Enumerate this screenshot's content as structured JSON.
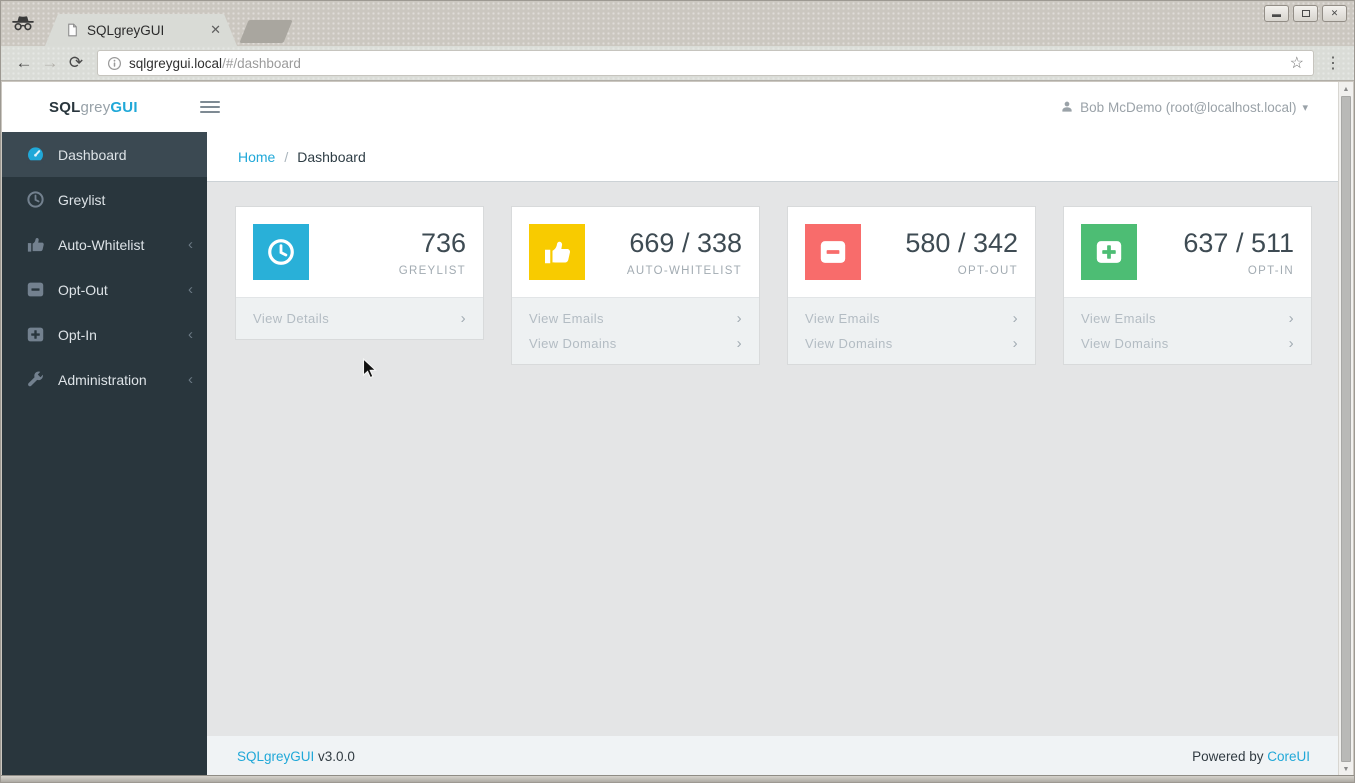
{
  "browser": {
    "tab": {
      "title": "SQLgreyGUI"
    },
    "address": {
      "domain": "sqlgreygui.local",
      "path": "/#/dashboard"
    }
  },
  "header": {
    "logo": {
      "part1": "SQL",
      "part2": "grey",
      "part3": "GUI"
    },
    "user": {
      "name": "Bob McDemo (root@localhost.local)"
    }
  },
  "breadcrumb": {
    "home": "Home",
    "separator": "/",
    "current": "Dashboard"
  },
  "sidebar": {
    "items": [
      {
        "label": "Dashboard",
        "icon": "tachometer-icon",
        "active": true,
        "expandable": false
      },
      {
        "label": "Greylist",
        "icon": "clock-icon",
        "active": false,
        "expandable": false
      },
      {
        "label": "Auto-Whitelist",
        "icon": "thumbs-up-icon",
        "active": false,
        "expandable": true
      },
      {
        "label": "Opt-Out",
        "icon": "minus-square-icon",
        "active": false,
        "expandable": true
      },
      {
        "label": "Opt-In",
        "icon": "plus-square-icon",
        "active": false,
        "expandable": true
      },
      {
        "label": "Administration",
        "icon": "wrench-icon",
        "active": false,
        "expandable": true
      }
    ]
  },
  "cards": [
    {
      "value": "736",
      "label": "GREYLIST",
      "color": "#29b0d8",
      "icon": "clock-icon",
      "links": [
        "View Details"
      ]
    },
    {
      "value": "669 / 338",
      "label": "AUTO-WHITELIST",
      "color": "#f8cb00",
      "icon": "thumbs-up-icon",
      "links": [
        "View Emails",
        "View Domains"
      ]
    },
    {
      "value": "580 / 342",
      "label": "OPT-OUT",
      "color": "#f86c6b",
      "icon": "minus-square-icon",
      "links": [
        "View Emails",
        "View Domains"
      ]
    },
    {
      "value": "637 / 511",
      "label": "OPT-IN",
      "color": "#4dbd74",
      "icon": "plus-square-icon",
      "links": [
        "View Emails",
        "View Domains"
      ]
    }
  ],
  "footer": {
    "app_name": "SQLgreyGUI",
    "version": "v3.0.0",
    "powered_by": "Powered by",
    "powered_link": "CoreUI"
  },
  "colors": {
    "accent": "#20a8d8",
    "sidebar_bg": "#29363d",
    "sidebar_active_bg": "#3b4952",
    "info": "#29b0d8",
    "warning": "#f8cb00",
    "danger": "#f86c6b",
    "success": "#4dbd74"
  }
}
